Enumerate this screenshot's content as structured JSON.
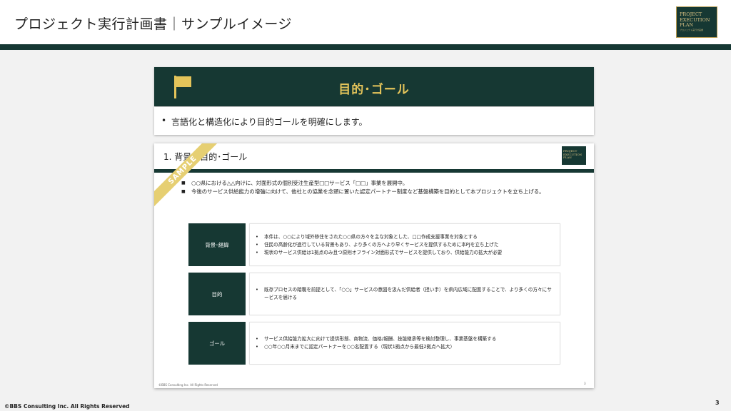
{
  "header": {
    "title": "プロジェクト実行計画書｜サンプルイメージ",
    "logo_lines": [
      "PROJECT",
      "EXECUTION",
      "PLAN"
    ],
    "logo_sub": "プロジェクト実行計画書",
    "brand_color": "#163833",
    "accent_color": "#e4c45a"
  },
  "goal_card": {
    "icon": "flag-icon",
    "title": "目的･ゴール"
  },
  "desc_card": {
    "bullet": "•",
    "text": "言語化と構造化により目的ゴールを明確にします。"
  },
  "inner": {
    "title": "1. 背景・目的･ゴール",
    "logo_lines": [
      "PROJECT",
      "EXECUTION",
      "PLAN"
    ],
    "ribbon": "SAMPLE",
    "bullets": [
      "○○県における△△向けに、対面形式の個別受注生産型□□サービス「□□」事業を展開中。",
      "今後のサービス供給能力の増強に向けて、他社との協業を念頭に置いた認定パートナー制度など基盤構築を目的として本プロジェクトを立ち上げる。"
    ],
    "rows": [
      {
        "label": "背景･経緯",
        "items": [
          "本件は、○○により域外移住をされた○○県の方々を主な対象とした、□□作成支援事業を対象とする",
          "住民の高齢化が進行している背景もあり、より多くの方へより早くサービスを提供するために本PJを立ち上げた",
          "現状のサービス供給は1拠点のみ且つ原則オフライン対面形式でサービスを提供しており、供給能力の拡大が必要"
        ]
      },
      {
        "label": "目的",
        "items": [
          "既存プロセスの踏襲を前提として、「○○」サービスの意図を汲んだ供給者（担い手）を県内広域に配置することで、より多くの方々にサービスを届ける"
        ]
      },
      {
        "label": "ゴール",
        "items": [
          "サービス供給能力拡大に向けて提供形態、商物流、価格/報酬、技能継承等を検討整理し、事業基盤を構築する",
          "○○年○○月末までに認定パートナーを○○名配置する（現状1拠点から最低2拠点へ拡大）"
        ]
      }
    ],
    "footer": "©BBS Consulting Inc. All Rights Reserved",
    "page": "3"
  },
  "footer": {
    "copyright": "©BBS Consulting Inc. All Rights Reserved",
    "page_number": "3"
  }
}
